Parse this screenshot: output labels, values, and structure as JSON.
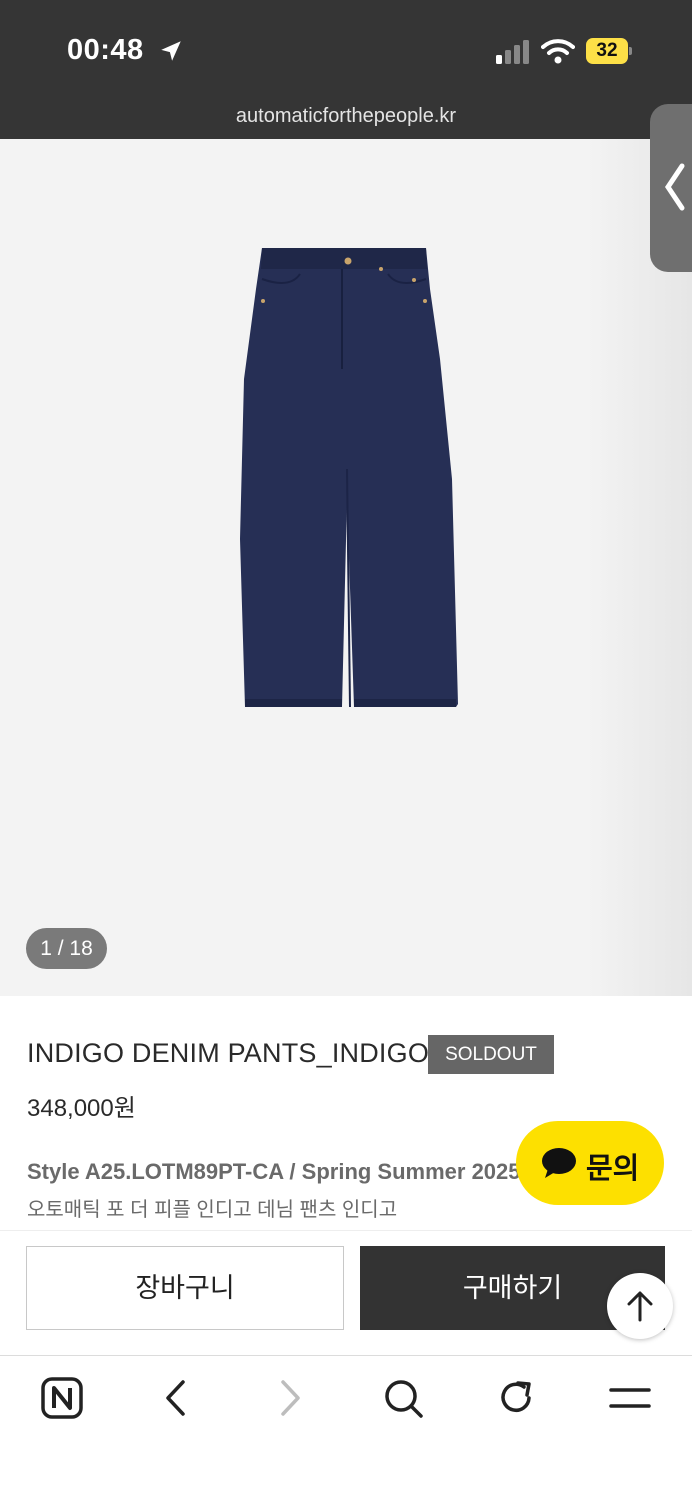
{
  "status_bar": {
    "time": "00:48",
    "battery": "32"
  },
  "address_bar": {
    "url": "automaticforthepeople.kr"
  },
  "gallery": {
    "counter": "1 / 18",
    "image_alt": "INDIGO DENIM PANTS_INDIGO"
  },
  "product": {
    "title": "INDIGO DENIM PANTS_INDIGO",
    "badge": "SOLDOUT",
    "price": "348,000원",
    "style_line": "Style A25.LOTM89PT-CA / Spring Summer 2025",
    "korean_name": "오토매틱 포 더 피플 인디고 데님 팬츠 인디고"
  },
  "chat": {
    "label": "문의",
    "color": "#fde000"
  },
  "actions": {
    "cart_label": "장바구니",
    "buy_label": "구매하기"
  },
  "colors": {
    "topbar": "#353535",
    "badge": "#666666",
    "buy": "#333333",
    "denim": "#262f55"
  }
}
